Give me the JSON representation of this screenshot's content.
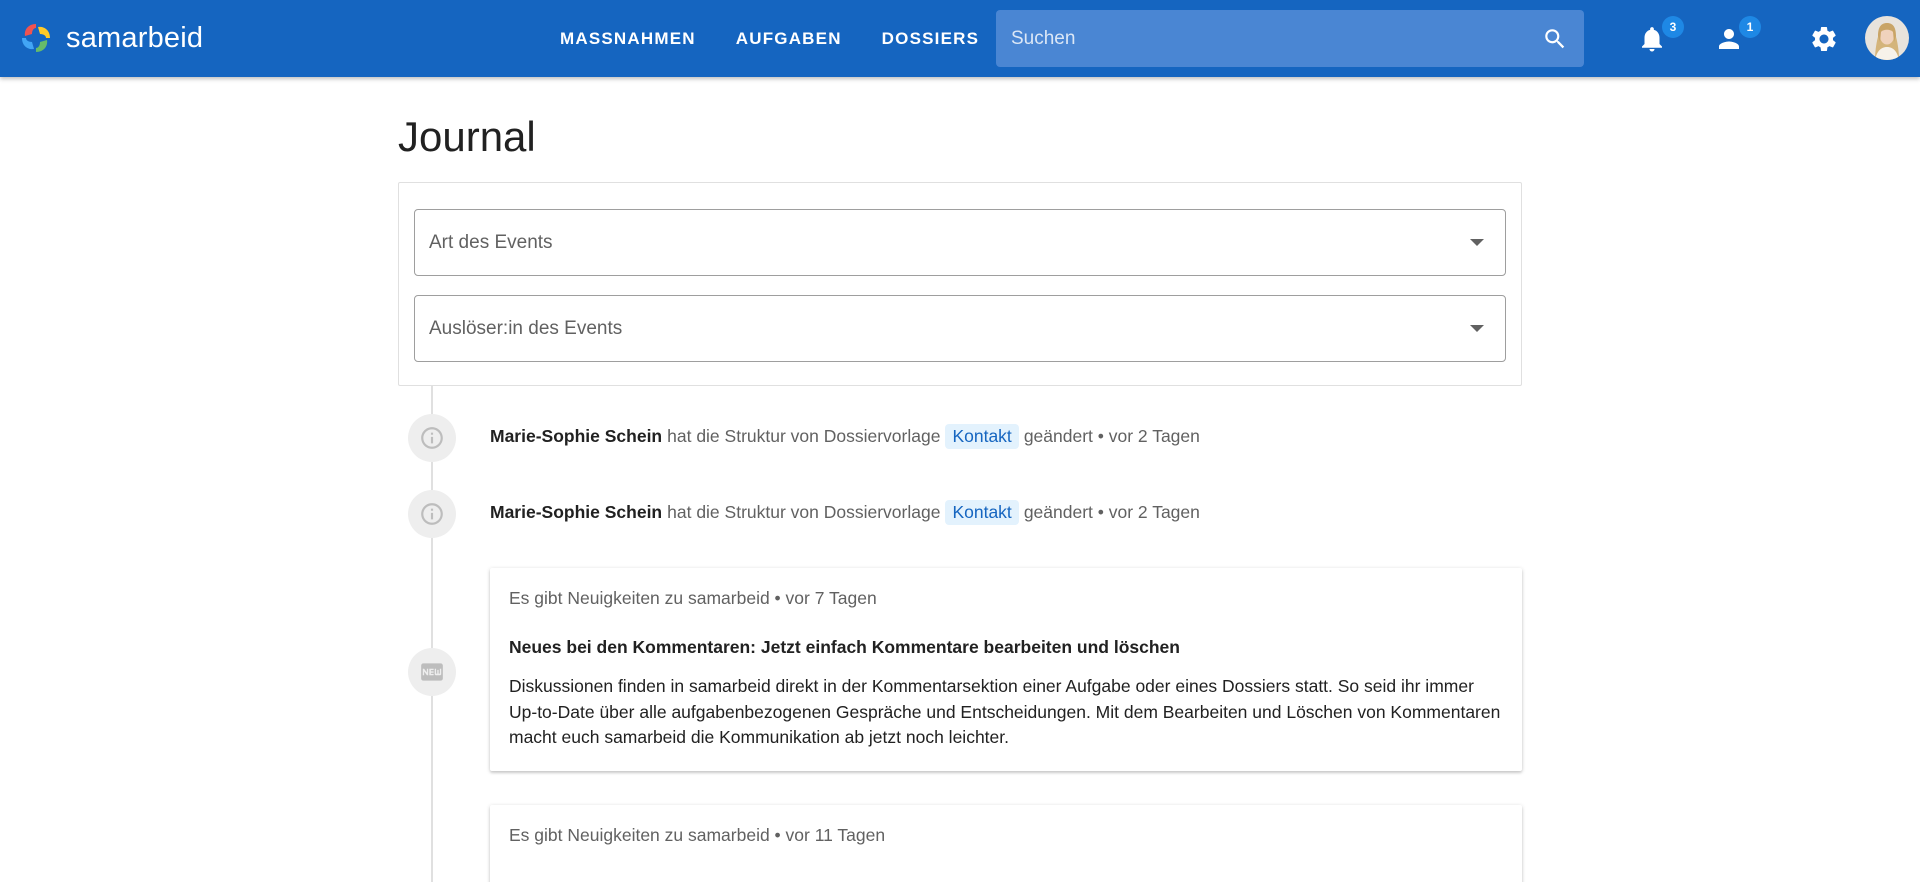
{
  "header": {
    "app_name": "samarbeid",
    "nav": [
      "MASSNAHMEN",
      "AUFGABEN",
      "DOSSIERS"
    ],
    "search_placeholder": "Suchen",
    "notifications_count": "3",
    "users_count": "1",
    "brand_color": "#1565c0"
  },
  "main": {
    "title": "Journal",
    "filters": {
      "event_type_label": "Art des Events",
      "event_actor_label": "Auslöser:in des Events"
    },
    "events": [
      {
        "actor": "Marie-Sophie Schein",
        "text_before": "hat die Struktur von Dossiervorlage",
        "chip": "Kontakt",
        "text_after": "geändert • vor 2 Tagen",
        "icon": "info-icon"
      },
      {
        "actor": "Marie-Sophie Schein",
        "text_before": "hat die Struktur von Dossiervorlage",
        "chip": "Kontakt",
        "text_after": "geändert • vor 2 Tagen",
        "icon": "info-icon"
      }
    ],
    "news": [
      {
        "meta": "Es gibt Neuigkeiten zu samarbeid • vor 7 Tagen",
        "title": "Neues bei den Kommentaren: Jetzt einfach Kommentare bearbeiten und löschen",
        "body": "Diskussionen finden in samarbeid direkt in der Kommentarsektion einer Aufgabe oder eines Dossiers statt. So seid ihr immer Up-to-Date über alle aufgabenbezogenen Gespräche und Entscheidungen. Mit dem Bearbeiten und Löschen von Kommentaren macht euch samarbeid die Kommunikation ab jetzt noch leichter.",
        "icon": "new-badge-icon"
      },
      {
        "meta": "Es gibt Neuigkeiten zu samarbeid • vor 11 Tagen"
      }
    ]
  }
}
